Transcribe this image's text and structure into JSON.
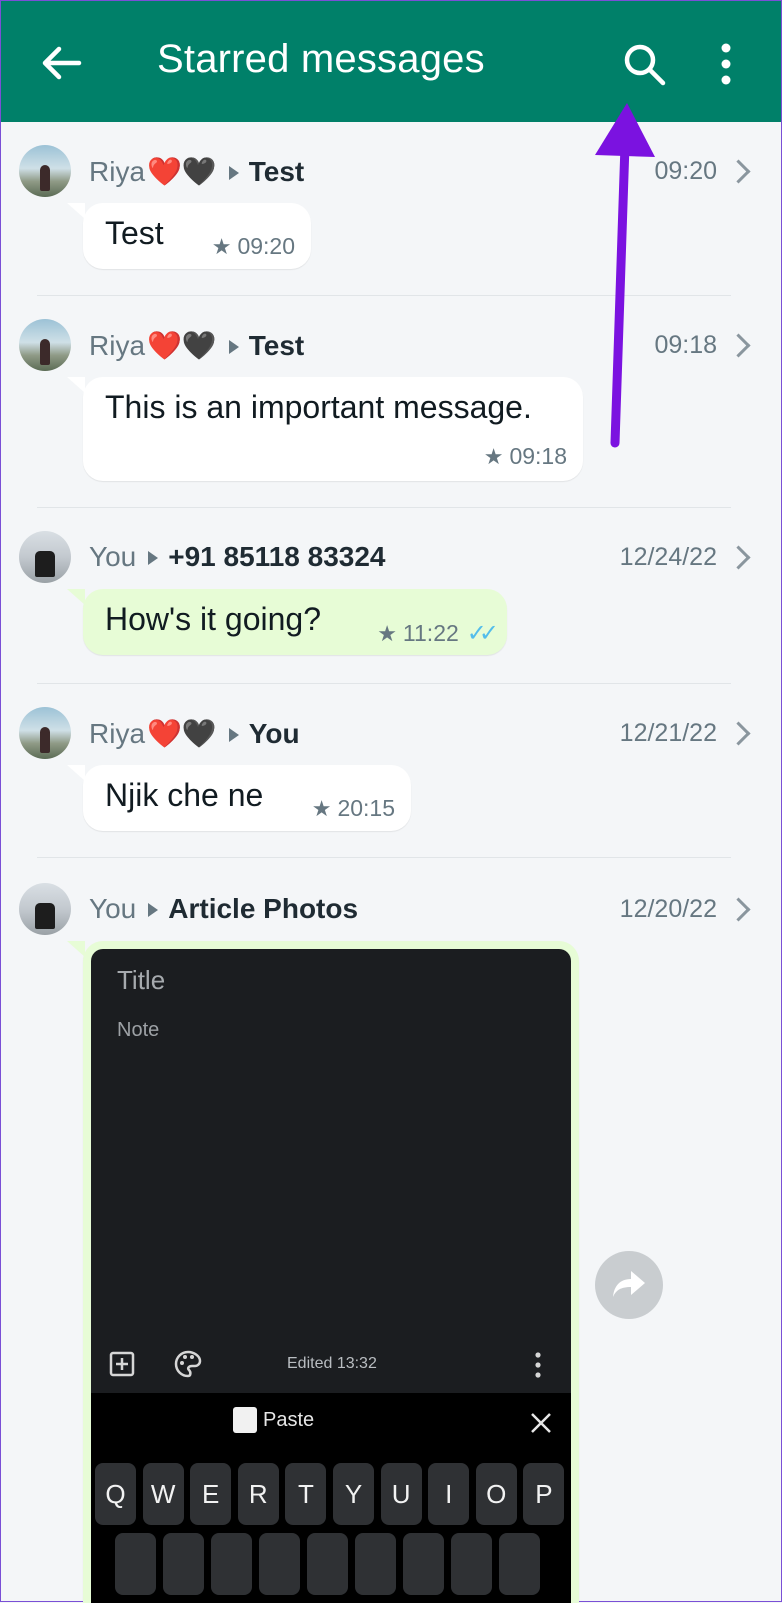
{
  "header": {
    "title": "Starred messages"
  },
  "messages": [
    {
      "sender": "Riya",
      "hearts": "❤️🖤",
      "chat": "Test",
      "date": "09:20",
      "text": "Test",
      "time": "09:20",
      "outgoing": false
    },
    {
      "sender": "Riya",
      "hearts": "❤️🖤",
      "chat": "Test",
      "date": "09:18",
      "text": "This is an important message.",
      "time": "09:18",
      "outgoing": false
    },
    {
      "sender": "You",
      "hearts": "",
      "chat": "+91 85118 83324",
      "date": "12/24/22",
      "text": "How's it going?",
      "time": "11:22",
      "outgoing": true
    },
    {
      "sender": "Riya",
      "hearts": "❤️🖤",
      "chat": "You",
      "date": "12/21/22",
      "text": "Njik che ne",
      "time": "20:15",
      "outgoing": false
    },
    {
      "sender": "You",
      "hearts": "",
      "chat": "Article Photos",
      "date": "12/20/22",
      "outgoing": true
    }
  ],
  "photo": {
    "title": "Title",
    "note": "Note",
    "edited": "Edited 13:32",
    "paste": "Paste",
    "keys_row1": [
      "Q",
      "W",
      "E",
      "R",
      "T",
      "Y",
      "U",
      "I",
      "O",
      "P"
    ]
  },
  "colors": {
    "appbar": "#008069",
    "outgoing_bubble": "#e7fcd6",
    "read_ticks": "#53bdeb",
    "annotation_arrow": "#7b12e0"
  }
}
